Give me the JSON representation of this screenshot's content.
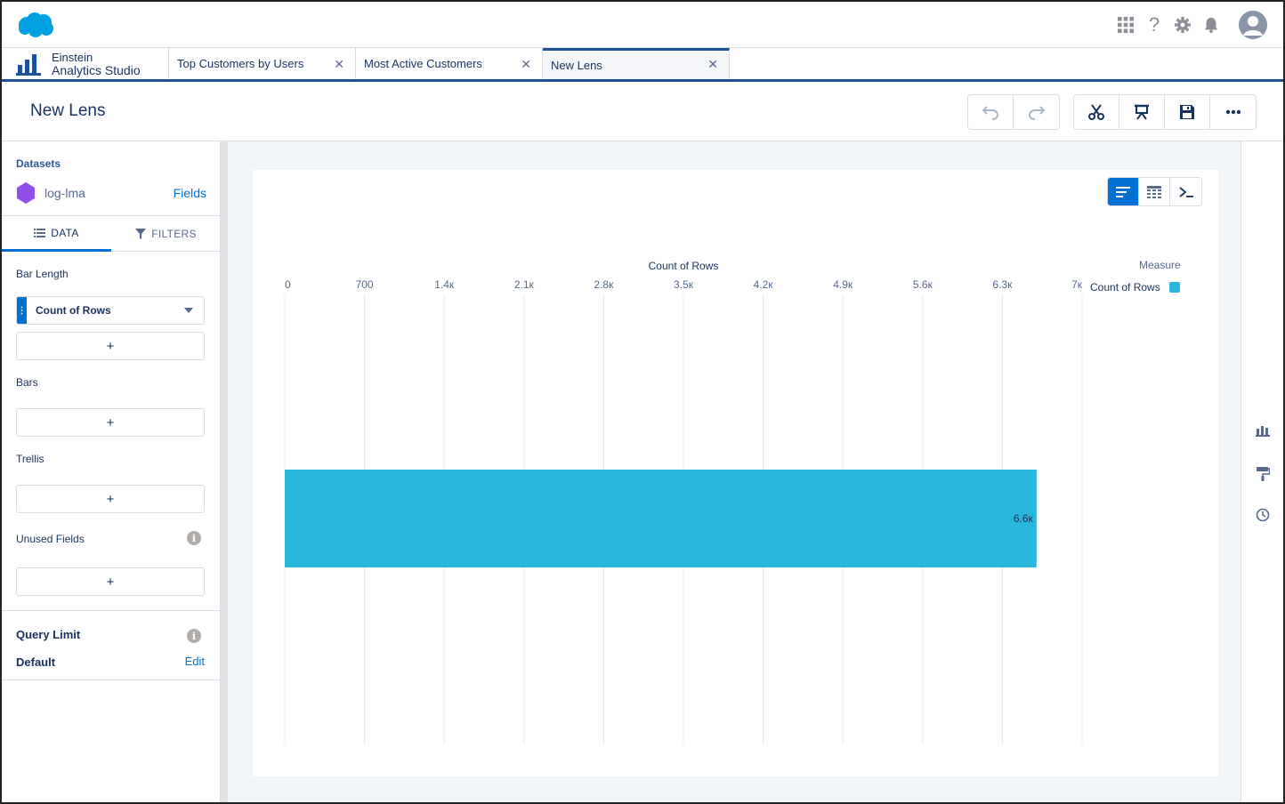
{
  "header": {
    "icons": [
      "app-launcher-icon",
      "help-icon",
      "setup-gear-icon",
      "notifications-bell-icon",
      "user-avatar-icon"
    ]
  },
  "tabs": {
    "app_line1": "Einstein",
    "app_line2": "Analytics Studio",
    "items": [
      {
        "label": "Top Customers by Users",
        "active": false
      },
      {
        "label": "Most Active Customers",
        "active": false
      },
      {
        "label": "New Lens",
        "active": true
      }
    ]
  },
  "page": {
    "title": "New Lens",
    "toolbar_icons": [
      "undo-icon",
      "redo-icon",
      "clip-scissors-icon",
      "present-icon",
      "save-icon",
      "more-actions-icon"
    ]
  },
  "left": {
    "datasets_label": "Datasets",
    "dataset_name": "log-lma",
    "fields_link": "Fields",
    "tab_data": "DATA",
    "tab_filters": "FILTERS",
    "bar_length_label": "Bar Length",
    "measure_pill": "Count of Rows",
    "add_symbol": "+",
    "bars_label": "Bars",
    "trellis_label": "Trellis",
    "unused_fields_label": "Unused Fields",
    "query_limit_label": "Query Limit",
    "query_limit_value": "Default",
    "edit_link": "Edit",
    "info_glyph": "i"
  },
  "view_toggle": [
    "chart-view-icon",
    "table-view-icon",
    "saql-console-icon"
  ],
  "legend": {
    "title": "Measure",
    "item": "Count of Rows",
    "color": "#29b8dc"
  },
  "chart_data": {
    "type": "bar",
    "orientation": "horizontal",
    "xlabel": "Count of Rows",
    "x_ticks": [
      "0",
      "700",
      "1.4к",
      "2.1к",
      "2.8к",
      "3.5к",
      "4.2к",
      "4.9к",
      "5.6к",
      "6.3к",
      "7к"
    ],
    "xlim": [
      0,
      7000
    ],
    "categories": [
      ""
    ],
    "values": [
      6600
    ],
    "data_labels": [
      "6.6к"
    ],
    "series": [
      {
        "name": "Count of Rows",
        "values": [
          6600
        ],
        "color": "#29b8dc"
      }
    ],
    "grid": true,
    "legend_position": "top-right"
  },
  "right_rail": {
    "icons": [
      "chart-type-icon",
      "format-paint-icon",
      "history-clock-icon"
    ]
  }
}
